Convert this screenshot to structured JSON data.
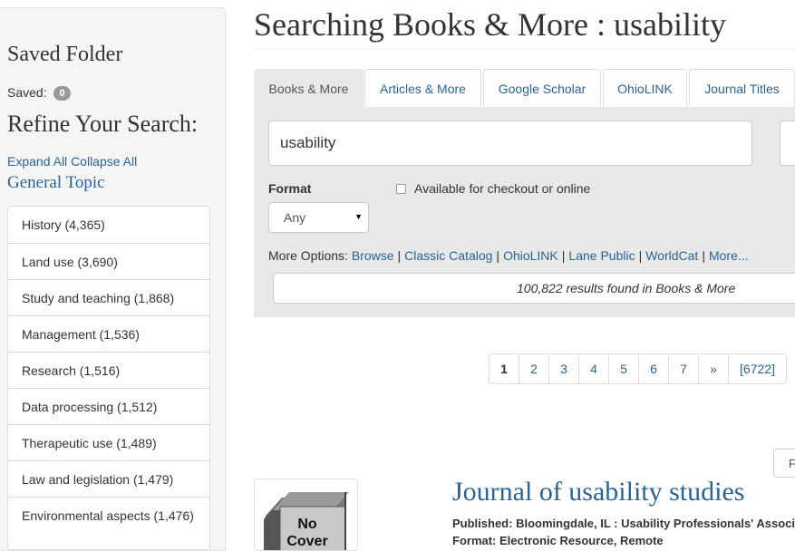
{
  "sidebar": {
    "saved_folder_title": "Saved Folder",
    "saved_label": "Saved:",
    "saved_count": "0",
    "refine_title": "Refine Your Search:",
    "expand_all": "Expand All",
    "collapse_all": "Collapse All",
    "topic_heading": "General Topic",
    "facets": [
      "History (4,365)",
      "Land use (3,690)",
      "Study and teaching (1,868)",
      "Management (1,536)",
      "Research (1,516)",
      "Data processing (1,512)",
      "Therapeutic use (1,489)",
      "Law and legislation (1,479)",
      "Environmental aspects (1,476)"
    ]
  },
  "header": {
    "title": "Searching Books & More : usability"
  },
  "tabs": [
    "Books & More",
    "Articles & More",
    "Google Scholar",
    "OhioLINK",
    "Journal Titles"
  ],
  "active_tab": "Books & More",
  "search": {
    "value": "usability",
    "format_label": "Format",
    "format_value": "Any",
    "available_label": "Available for checkout or online",
    "more_options_label": "More Options:",
    "more_options_links": [
      "Browse",
      "Classic Catalog",
      "OhioLINK",
      "Lane Public",
      "WorldCat",
      "More..."
    ],
    "results_text": "100,822 results found in Books & More"
  },
  "pagination": {
    "pages": [
      "1",
      "2",
      "3",
      "4",
      "5",
      "6",
      "7",
      "»",
      "[6722]"
    ],
    "current": "1"
  },
  "sort_stub_text": "F",
  "result": {
    "cover_text_1": "No",
    "cover_text_2": "Cover",
    "title": "Journal of usability studies",
    "published_label": "Published:",
    "published_value": "Bloomingdale, IL : Usability Professionals' Association",
    "format_label": "Format:",
    "format_value": "Electronic Resource, Remote"
  },
  "colors": {
    "link": "#2a6496",
    "panel_bg": "#e8e8e8",
    "sidebar_bg": "#f5f5f5",
    "badge_bg": "#999999"
  }
}
